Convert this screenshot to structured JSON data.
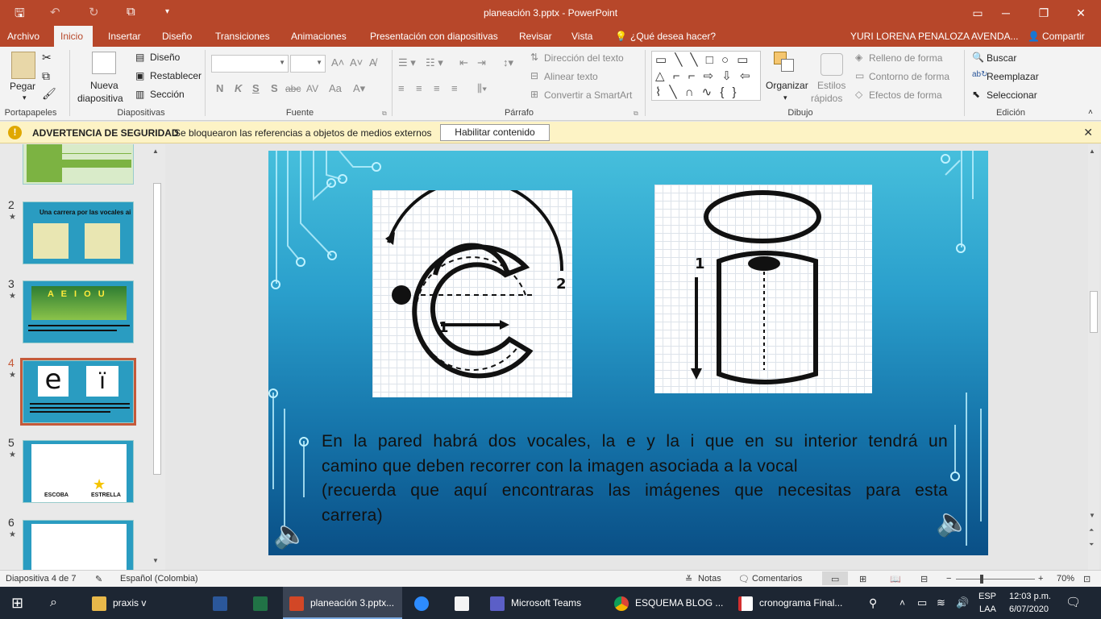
{
  "titlebar": {
    "title": "planeación 3.pptx - PowerPoint",
    "minimize": "─",
    "restore": "❐",
    "close": "✕",
    "restore_ribbon": "▭"
  },
  "tabs": {
    "items": [
      "Archivo",
      "Inicio",
      "Insertar",
      "Diseño",
      "Transiciones",
      "Animaciones",
      "Presentación con diapositivas",
      "Revisar",
      "Vista"
    ],
    "tell_me": "¿Qué desea hacer?",
    "user": "YURI LORENA PENALOZA AVENDA...",
    "share": "Compartir"
  },
  "ribbon": {
    "portapapeles": {
      "label": "Portapapeles",
      "paste": "Pegar"
    },
    "diapositivas": {
      "label": "Diapositivas",
      "new_slide_1": "Nueva",
      "new_slide_2": "diapositiva",
      "layout": "Diseño",
      "reset": "Restablecer",
      "section": "Sección"
    },
    "fuente": {
      "label": "Fuente",
      "bold": "N",
      "italic": "K",
      "underline": "S",
      "shadow": "S",
      "strike": "abc",
      "spacing": "AV",
      "case": "Aa"
    },
    "parrafo": {
      "label": "Párrafo",
      "text_dir": "Dirección del texto",
      "align_text": "Alinear texto",
      "smartart": "Convertir a SmartArt"
    },
    "dibujo": {
      "label": "Dibujo",
      "shapes": "▭ ╲ ╲ □ ○ ▭ △ ⌐ ⌐ ⇨ ⇩ ⇦ ⌇ ╲ ∩ ∿ { } ☆",
      "arrange": "Organizar",
      "styles_1": "Estilos",
      "styles_2": "rápidos",
      "fill": "Relleno de forma",
      "outline": "Contorno de forma",
      "effects": "Efectos de forma"
    },
    "edicion": {
      "label": "Edición",
      "find": "Buscar",
      "replace": "Reemplazar",
      "select": "Seleccionar"
    }
  },
  "warning": {
    "title": "ADVERTENCIA DE SEGURIDAD",
    "message": "Se bloquearon las referencias a objetos de medios externos",
    "button": "Habilitar contenido"
  },
  "thumbnails": [
    {
      "number": "2",
      "title": "Una carrera por las vocales ai"
    },
    {
      "number": "3",
      "title": "A E I O U"
    },
    {
      "number": "4",
      "title": ""
    },
    {
      "number": "5",
      "word1": "ESCOBA",
      "word2": "ESTRELLA"
    },
    {
      "number": "6",
      "title": ""
    }
  ],
  "slide": {
    "line1": "En la pared habrá dos vocales, la e y la i que en su interior tendrá un",
    "line2": "camino que deben recorrer con la imagen asociada a la vocal",
    "line3": "(recuerda que aquí encontraras las imágenes que necesitas para esta",
    "line4": "carrera)",
    "e_label1": "1",
    "e_label2": "2",
    "i_label1": "1"
  },
  "status": {
    "slide_info": "Diapositiva 4 de 7",
    "language": "Español (Colombia)",
    "notes": "Notas",
    "comments": "Comentarios",
    "zoom": "70%"
  },
  "taskbar": {
    "items": [
      "praxis v",
      "planeación 3.pptx...",
      "Microsoft Teams",
      "ESQUEMA BLOG ...",
      "cronograma Final..."
    ],
    "lang1": "ESP",
    "lang2": "LAA",
    "time": "12:03 p.m.",
    "date": "6/07/2020"
  },
  "colors": {
    "accent": "#b7472a",
    "warning_bg": "#fdf3c5",
    "slide_top": "#46bfdc",
    "slide_bottom": "#0a4f86"
  }
}
